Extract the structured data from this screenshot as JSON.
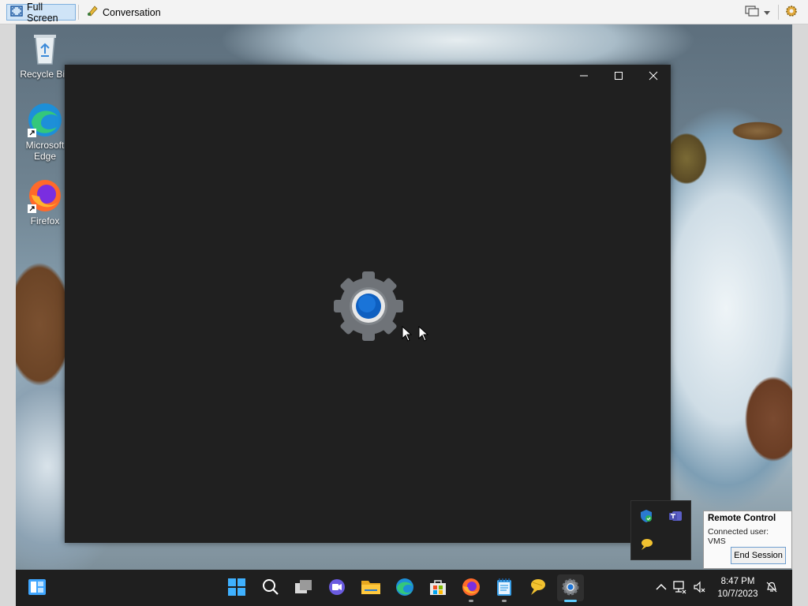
{
  "host_toolbar": {
    "full_screen_label": "Full Screen",
    "conversation_label": "Conversation"
  },
  "desktop_icons": [
    {
      "label": "Recycle Bin",
      "icon": "recycle-bin-icon"
    },
    {
      "label": "Microsoft Edge",
      "icon": "edge-icon"
    },
    {
      "label": "Firefox",
      "icon": "firefox-icon"
    }
  ],
  "settings_window": {
    "controls": [
      "minimize",
      "maximize",
      "close"
    ]
  },
  "remote_control": {
    "title": "Remote Control",
    "connected_user": "Connected user: VMS",
    "end_session_label": "End Session"
  },
  "taskbar": {
    "apps": [
      "start",
      "search",
      "task-view",
      "meet-now",
      "file-explorer",
      "edge",
      "store",
      "firefox",
      "notepad",
      "conversation",
      "settings"
    ],
    "time": "8:47 PM",
    "date": "10/7/2023"
  },
  "colors": {
    "accent": "#0067c0",
    "taskbar_active": "#60cdff",
    "window_bg": "#202020"
  }
}
